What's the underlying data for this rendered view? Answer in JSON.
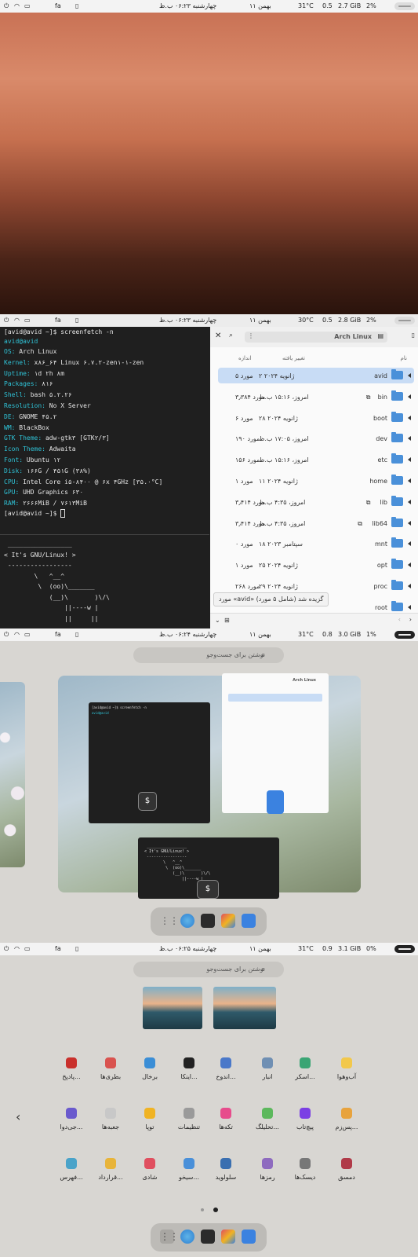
{
  "topbar": [
    {
      "datetime": "چهارشنبه ۰۶:۲۳ ب.ظ",
      "date": "۱۱ بهمن",
      "lang": "fa",
      "temp": "31°C",
      "load": "0.5",
      "mem": "2.7 GiB",
      "cpu": "2%"
    },
    {
      "datetime": "چهارشنبه ۰۶:۲۳ ب.ظ",
      "date": "۱۱ بهمن",
      "lang": "fa",
      "temp": "30°C",
      "load": "0.5",
      "mem": "2.8 GiB",
      "cpu": "2%"
    },
    {
      "datetime": "چهارشنبه ۰۶:۲۴ ب.ظ",
      "date": "۱۱ بهمن",
      "lang": "fa",
      "temp": "31°C",
      "load": "0.8",
      "mem": "3.0 GiB",
      "cpu": "1%"
    },
    {
      "datetime": "چهارشنبه ۰۶:۲۵ ب.ظ",
      "date": "۱۱ بهمن",
      "lang": "fa",
      "temp": "31°C",
      "load": "0.9",
      "mem": "3.1 GiB",
      "cpu": "0%"
    }
  ],
  "terminal": {
    "prompt": "[avid@avid ~]$ screenfetch -n",
    "userhost": "avid@avid",
    "info": [
      {
        "k": "OS:",
        "v": " Arch Linux"
      },
      {
        "k": "Kernel:",
        "v": " x۸۶_۶۴ Linux ۶.۷.۲-zen۱-۱-zen"
      },
      {
        "k": "Uptime:",
        "v": " ۱d ۲h ۸m"
      },
      {
        "k": "Packages:",
        "v": " ۸۱۶"
      },
      {
        "k": "Shell:",
        "v": " bash ۵.۲.۲۶"
      },
      {
        "k": "Resolution:",
        "v": " No X Server"
      },
      {
        "k": "DE:",
        "v": " GNOME ۴۵.۲"
      },
      {
        "k": "WM:",
        "v": " BlackBox"
      },
      {
        "k": "GTK Theme:",
        "v": " adw-gtk۳ [GTK۲/۳]"
      },
      {
        "k": "Icon Theme:",
        "v": " Adwaita"
      },
      {
        "k": "Font:",
        "v": " Ubuntu ۱۲"
      },
      {
        "k": "Disk:",
        "v": " ۱۶۶G / ۴۵۱G (۳۸%)"
      },
      {
        "k": "CPU:",
        "v": " Intel Core i۵-۸۴۰۰ @ ۶x ۴GHz [۳۵.۰°C]"
      },
      {
        "k": "GPU:",
        "v": " UHD Graphics ۶۳۰"
      },
      {
        "k": "RAM:",
        "v": " ۲۶۶۶MiB / ۷۶۱۳MiB"
      }
    ],
    "prompt2": "[avid@avid ~]$ ",
    "cowsay": [
      " _________________",
      "< It's GNU/Linux! >",
      " -----------------",
      "        \\   ^__^",
      "         \\  (oo)\\_______",
      "            (__)\\       )\\/\\",
      "                ||----w |",
      "                ||     ||"
    ]
  },
  "files": {
    "title": "Arch Linux",
    "col_name": "نام",
    "col_modified": "تغییر یافته",
    "col_size": "اندازه",
    "rows": [
      {
        "name": "avid",
        "date": "۲ ژانویه ۲۰۲۴",
        "size": "۵ مورد",
        "selected": true,
        "link": false
      },
      {
        "name": "bin",
        "date": "امروز، ۱۵:۱۶ ب.ظ",
        "size": "۳٫۳۸۴ مورد",
        "selected": false,
        "link": true
      },
      {
        "name": "boot",
        "date": "۲۸ ژانویه ۲۰۲۴",
        "size": "۶ مورد",
        "selected": false,
        "link": false
      },
      {
        "name": "dev",
        "date": "امروز، ۱۷:۰۵ ب.ظ",
        "size": "۱۹۰ مورد",
        "selected": false,
        "link": false
      },
      {
        "name": "etc",
        "date": "امروز، ۱۵:۱۶ ب.ظ",
        "size": "۱۵۶ مورد",
        "selected": false,
        "link": false
      },
      {
        "name": "home",
        "date": "۱۱ ژانویه ۲۰۲۴",
        "size": "۱ مورد",
        "selected": false,
        "link": false
      },
      {
        "name": "lib",
        "date": "امروز، ۴:۳۵ ب.ظ",
        "size": "۳٫۴۱۴ مورد",
        "selected": false,
        "link": true
      },
      {
        "name": "lib64",
        "date": "امروز، ۴:۳۵ ب.ظ",
        "size": "۳٫۴۱۴ مورد",
        "selected": false,
        "link": true
      },
      {
        "name": "mnt",
        "date": "۱۸ سپتامبر ۲۰۲۳",
        "size": "۰ مورد",
        "selected": false,
        "link": false
      },
      {
        "name": "opt",
        "date": "۲۵ ژانویه ۲۰۲۴",
        "size": "۱ مورد",
        "selected": false,
        "link": false
      },
      {
        "name": "proc",
        "date": "۲۹ ژانویه ۲۰۲۴",
        "size": "۲۶۸ مورد",
        "selected": false,
        "link": false
      },
      {
        "name": "root",
        "date": "",
        "size": "",
        "selected": false,
        "link": false
      }
    ],
    "status": "مورد «avid» گزیده شد (شامل ۵ مورد)"
  },
  "search_placeholder": "نوشتن برای جست‌وجو",
  "colors": {
    "accent": "#4a90d9",
    "cyan": "#2fc2d6",
    "terminal_bg": "#1f1f1f"
  },
  "apps": [
    [
      {
        "label": "آب‌وهوا",
        "color": "#f2c84b",
        "icon": "weather-icon"
      },
      {
        "label": "اسکر...",
        "color": "#3aa574",
        "icon": "screenshot-icon"
      },
      {
        "label": "انبار",
        "color": "#6f8fb3",
        "icon": "archive-icon"
      },
      {
        "label": "اندوخ...",
        "color": "#4a78c9",
        "icon": "save-icon"
      },
      {
        "label": "اینکا...",
        "color": "#222222",
        "icon": "inkscape-icon"
      },
      {
        "label": "برخال",
        "color": "#3b8ed6",
        "icon": "fractal-icon"
      },
      {
        "label": "بطری‌ها",
        "color": "#d9534f",
        "icon": "bottles-icon"
      },
      {
        "label": "پادپخ...",
        "color": "#c9302c",
        "icon": "podcast-icon"
      }
    ],
    [
      {
        "label": "پس‌زم...",
        "color": "#e8a33d",
        "icon": "wallpaper-icon"
      },
      {
        "label": "پیچ‌تاب",
        "color": "#7b3fe4",
        "icon": "tweaks-icon"
      },
      {
        "label": "تحلیلگ...",
        "color": "#5cb85c",
        "icon": "analyzer-icon"
      },
      {
        "label": "تکه‌ها",
        "color": "#e74c8c",
        "icon": "fragments-icon"
      },
      {
        "label": "تنظیمات",
        "color": "#9a9a9a",
        "icon": "settings-icon"
      },
      {
        "label": "توپا",
        "color": "#f0b323",
        "icon": "tuba-icon"
      },
      {
        "label": "جعبه‌ها",
        "color": "#c8c8c8",
        "icon": "boxes-icon"
      },
      {
        "label": "جی‌دوا...",
        "color": "#6a5acd",
        "icon": "gdown-icon"
      }
    ],
    [
      {
        "label": "دمسق",
        "color": "#b03a48",
        "icon": "damask-icon"
      },
      {
        "label": "دیسک‌ها",
        "color": "#777777",
        "icon": "disks-icon"
      },
      {
        "label": "رمزها",
        "color": "#8e6bbf",
        "icon": "passwords-icon"
      },
      {
        "label": "سلولوید",
        "color": "#3a6fb0",
        "icon": "celluloid-icon"
      },
      {
        "label": "سیخو...",
        "color": "#4a90d9",
        "icon": "sikho-icon"
      },
      {
        "label": "شادی",
        "color": "#e04f5f",
        "icon": "shadi-icon"
      },
      {
        "label": "قرارداد...",
        "color": "#e8b43a",
        "icon": "contract-icon"
      },
      {
        "label": "فهرس...",
        "color": "#4aa3c9",
        "icon": "index-icon"
      }
    ]
  ]
}
